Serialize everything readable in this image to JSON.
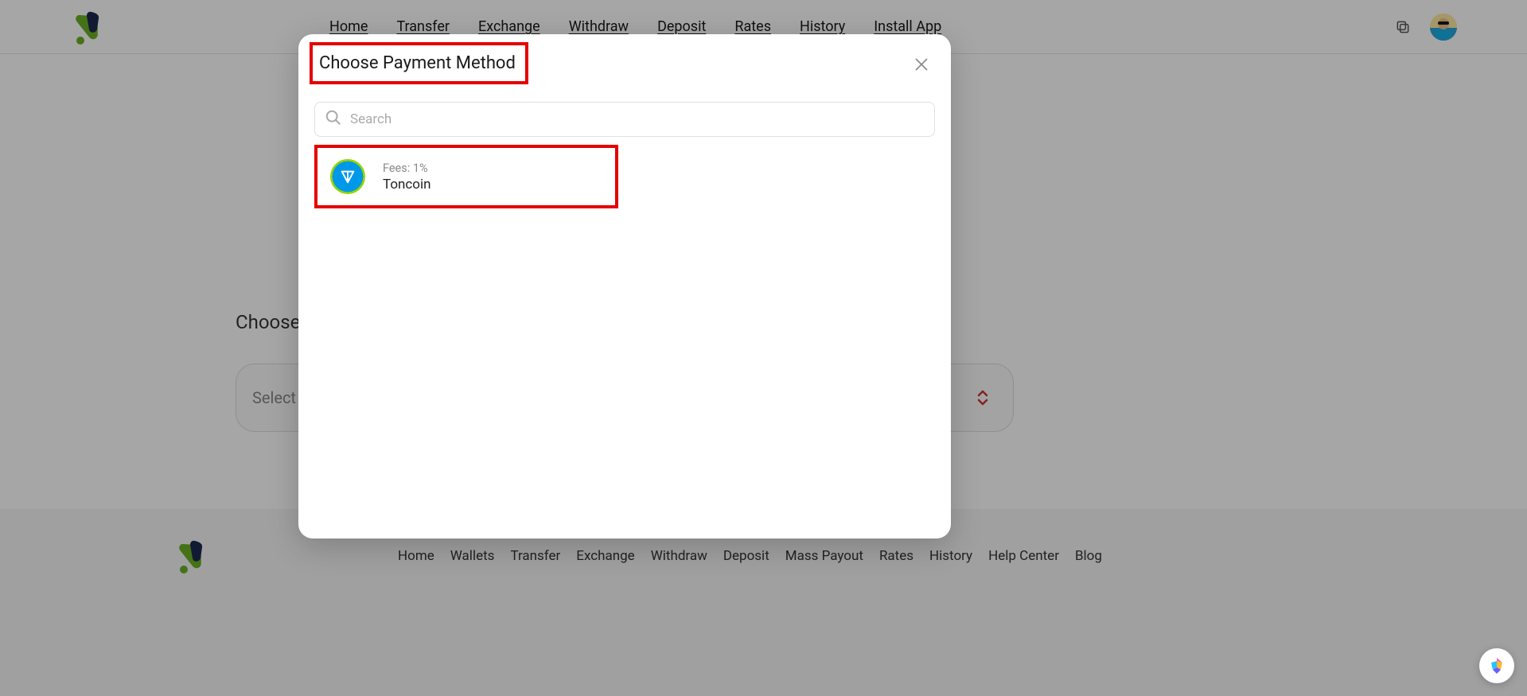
{
  "nav": {
    "links": [
      "Home",
      "Transfer",
      "Exchange",
      "Withdraw",
      "Deposit",
      "Rates",
      "History",
      "Install App"
    ]
  },
  "page": {
    "choose_label": "Choose P",
    "select_placeholder": "Select P"
  },
  "footer": {
    "links": [
      "Home",
      "Wallets",
      "Transfer",
      "Exchange",
      "Withdraw",
      "Deposit",
      "Mass Payout",
      "Rates",
      "History",
      "Help Center",
      "Blog"
    ]
  },
  "modal": {
    "title": "Choose Payment Method",
    "search_placeholder": "Search",
    "items": [
      {
        "fees_label": "Fees:  1%",
        "name": "Toncoin"
      }
    ]
  }
}
